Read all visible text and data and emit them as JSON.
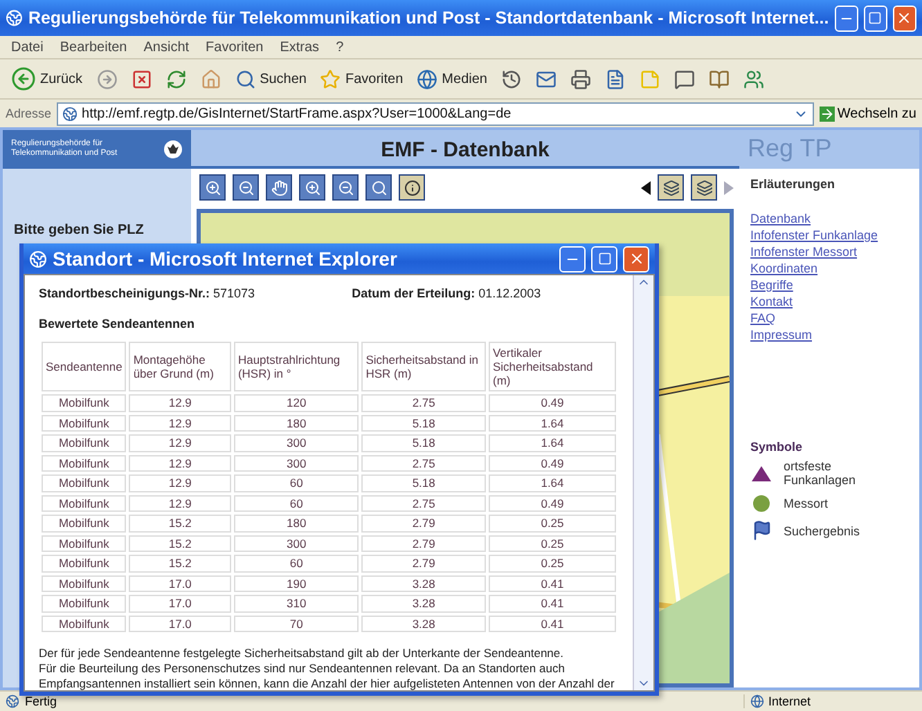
{
  "window": {
    "title": "Regulierungsbehörde für Telekommunikation und Post - Standortdatenbank - Microsoft Internet..."
  },
  "menu": [
    "Datei",
    "Bearbeiten",
    "Ansicht",
    "Favoriten",
    "Extras",
    "?"
  ],
  "toolbar": [
    {
      "kind": "back",
      "label": "Zurück"
    },
    {
      "kind": "forward"
    },
    {
      "kind": "stop"
    },
    {
      "kind": "refresh"
    },
    {
      "kind": "home"
    },
    {
      "kind": "search",
      "label": "Suchen"
    },
    {
      "kind": "favorites",
      "label": "Favoriten"
    },
    {
      "kind": "media",
      "label": "Medien"
    },
    {
      "kind": "history"
    },
    {
      "kind": "mail"
    },
    {
      "kind": "print"
    },
    {
      "kind": "edit"
    },
    {
      "kind": "note"
    },
    {
      "kind": "messenger"
    },
    {
      "kind": "research"
    },
    {
      "kind": "people"
    }
  ],
  "address": {
    "label": "Adresse",
    "url": "http://emf.regtp.de/GisInternet/StartFrame.aspx?User=1000&Lang=de",
    "go": "Wechseln zu"
  },
  "page": {
    "logo_text": "Regulierungsbehörde für Telekommunikation und Post",
    "title": "EMF - Datenbank",
    "brand": "Reg TP",
    "prompt": "Bitte geben Sie PLZ",
    "map_tools": [
      {
        "kind": "zoom-in"
      },
      {
        "kind": "zoom-out"
      },
      {
        "kind": "pan"
      },
      {
        "kind": "zoom-in"
      },
      {
        "kind": "zoom-out"
      },
      {
        "kind": "search"
      },
      {
        "kind": "info"
      }
    ],
    "map_nav": [
      {
        "kind": "prev"
      },
      {
        "kind": "layers"
      },
      {
        "kind": "layers"
      },
      {
        "kind": "next"
      }
    ],
    "sidebar": {
      "heading": "Erläuterungen",
      "links": [
        "Datenbank",
        "Infofenster Funkanlage",
        "Infofenster Messort",
        "Koordinaten",
        "Begriffe",
        "Kontakt",
        "FAQ",
        "Impressum"
      ]
    },
    "legend": {
      "heading": "Symbole",
      "items": [
        {
          "kind": "triangle",
          "label": "ortsfeste Funkanlagen"
        },
        {
          "kind": "dot",
          "label": "Messort"
        },
        {
          "kind": "flag",
          "label": "Suchergebnis"
        }
      ]
    }
  },
  "popup": {
    "title": "Standort - Microsoft Internet Explorer",
    "cert_label": "Standortbescheinigungs-Nr.:",
    "cert_value": "571073",
    "date_label": "Datum der Erteilung:",
    "date_value": "01.12.2003",
    "section": "Bewertete Sendeantennen",
    "columns": [
      "Sendeantenne",
      "Montagehöhe über Grund (m)",
      "Hauptstrahlrichtung (HSR) in °",
      "Sicherheitsabstand in HSR (m)",
      "Vertikaler Sicherheitsabstand (m)"
    ],
    "rows": [
      [
        "Mobilfunk",
        "12.9",
        "120",
        "2.75",
        "0.49"
      ],
      [
        "Mobilfunk",
        "12.9",
        "180",
        "5.18",
        "1.64"
      ],
      [
        "Mobilfunk",
        "12.9",
        "300",
        "5.18",
        "1.64"
      ],
      [
        "Mobilfunk",
        "12.9",
        "300",
        "2.75",
        "0.49"
      ],
      [
        "Mobilfunk",
        "12.9",
        "60",
        "5.18",
        "1.64"
      ],
      [
        "Mobilfunk",
        "12.9",
        "60",
        "2.75",
        "0.49"
      ],
      [
        "Mobilfunk",
        "15.2",
        "180",
        "2.79",
        "0.25"
      ],
      [
        "Mobilfunk",
        "15.2",
        "300",
        "2.79",
        "0.25"
      ],
      [
        "Mobilfunk",
        "15.2",
        "60",
        "2.79",
        "0.25"
      ],
      [
        "Mobilfunk",
        "17.0",
        "190",
        "3.28",
        "0.41"
      ],
      [
        "Mobilfunk",
        "17.0",
        "310",
        "3.28",
        "0.41"
      ],
      [
        "Mobilfunk",
        "17.0",
        "70",
        "3.28",
        "0.41"
      ]
    ],
    "notes": [
      "Der für jede Sendeantenne festgelegte Sicherheitsabstand gilt ab der Unterkante der Sendeantenne.",
      "Für die Beurteilung des Personenschutzes sind nur Sendeantennen relevant. Da an Standorten auch Empfangsantennen installiert sein können, kann die Anzahl der hier aufgelisteten Antennen von der Anzahl der"
    ]
  },
  "status_bar": {
    "text": "Fertig",
    "zone": "Internet"
  }
}
